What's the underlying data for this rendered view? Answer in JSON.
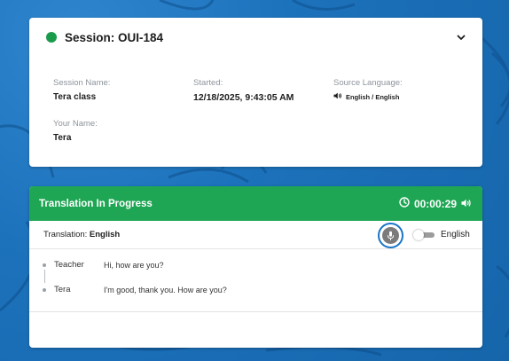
{
  "session": {
    "title": "Session: OUI-184",
    "status_color": "#1a9b4b",
    "fields": {
      "session_name_label": "Session Name:",
      "session_name_value": "Tera class",
      "started_label": "Started:",
      "started_value": "12/18/2025, 9:43:05 AM",
      "source_language_label": "Source Language:",
      "source_language_value": "English / English",
      "your_name_label": "Your Name:",
      "your_name_value": "Tera"
    }
  },
  "translation": {
    "header_title": "Translation In Progress",
    "header_color": "#1fa654",
    "timer": "00:00:29",
    "label_prefix": "Translation: ",
    "label_language": "English",
    "toggle_language": "English",
    "toggle_on": false,
    "messages": [
      {
        "speaker": "Teacher",
        "text": "Hi, how are you?"
      },
      {
        "speaker": "Tera",
        "text": "I'm good, thank you. How are you?"
      }
    ]
  },
  "icons": {
    "status": "status-dot",
    "expand": "chevron-down-icon",
    "speaker": "speaker-icon",
    "clock": "clock-icon",
    "volume": "volume-icon",
    "mic": "microphone-icon"
  },
  "colors": {
    "background": "#1b6fb8",
    "mic_ring": "#1a75c7",
    "mic_fill": "#7b7b7b"
  }
}
